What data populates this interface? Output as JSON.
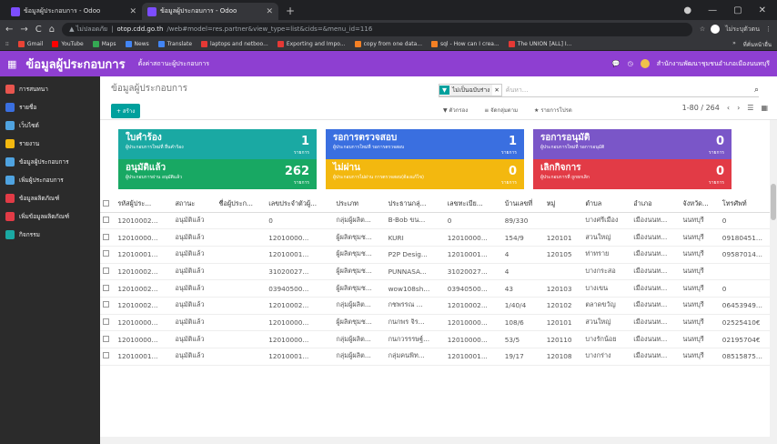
{
  "browser": {
    "tabs": [
      {
        "title": "ข้อมูลผู้ประกอบการ - Odoo",
        "active": false
      },
      {
        "title": "ข้อมูลผู้ประกอบการ - Odoo",
        "active": true
      }
    ],
    "new_tab": "+",
    "nav_back": "←",
    "nav_forward": "→",
    "nav_reload": "C",
    "nav_home": "⌂",
    "url_secure_label": "▲ ไม่ปลอดภัย",
    "url_host": "otop.cdd.go.th",
    "url_path": "/web#model=res.partner&view_type=list&cids=&menu_id=116",
    "profile_label": "ไม่ระบุตัวตน",
    "bookmarks": [
      "Gmail",
      "YouTube",
      "Maps",
      "News",
      "Translate",
      "laptops and netboo...",
      "Exporting and Impo...",
      "copy from one data...",
      "sql - How can I crea...",
      "The UNION [ALL] I..."
    ],
    "bookmarks_more": "»",
    "bookmarks_other": "ที่คั่นหน้าอื่น"
  },
  "odoo": {
    "brand": "ข้อมูลผู้ประกอบการ",
    "menu": "ตั้งค่าสถานะผู้ประกอบการ",
    "org": "สำนักงานพัฒนาชุมชนอำเภอเมืองนนทบุรี",
    "sidebar": [
      "การสนทนา",
      "รายชื่อ",
      "เว็บไซต์",
      "รายงาน",
      "ข้อมูลผู้ประกอบการ",
      "เพิ่มผู้ประกอบการ",
      "ข้อมูลผลิตภัณฑ์",
      "เพิ่มข้อมูลผลิตภัณฑ์",
      "กิจกรรม"
    ],
    "breadcrumb": "ข้อมูลผู้ประกอบการ",
    "create_button": "+ สร้าง",
    "facet_value": "ไม่เป็นฉบับร่าง",
    "search_placeholder": "ค้นหา...",
    "filters": [
      "▼ ตัวกรอง",
      "≡ จัดกลุ่มตาม",
      "★ รายการโปรด"
    ],
    "pager": "1-80 / 264",
    "tiles": [
      {
        "title": "ใบคำร้อง",
        "sub": "ผู้ประกอบการใหม่ที่ ยื่นคำร้อง",
        "count": "1",
        "unit": "รายการ",
        "color": "#1aa9a3"
      },
      {
        "title": "รอการตรวจสอบ",
        "sub": "ผู้ประกอบการใหม่ที่ รอการตรวจสอบ",
        "count": "1",
        "unit": "รายการ",
        "color": "#3a6fe0"
      },
      {
        "title": "รอการอนุมัติ",
        "sub": "ผู้ประกอบการใหม่ที่ รอการอนุมัติ",
        "count": "0",
        "unit": "รายการ",
        "color": "#7a56c8"
      },
      {
        "title": "อนุมัติแล้ว",
        "sub": "ผู้ประกอบการผ่าน อนุมัติแล้ว",
        "count": "262",
        "unit": "รายการ",
        "color": "#18a863"
      },
      {
        "title": "ไม่ผ่าน",
        "sub": "ผู้ประกอบการไม่ผ่าน การตรวจสอบ(ต้องแก้ไข)",
        "count": "0",
        "unit": "รายการ",
        "color": "#f3b80f"
      },
      {
        "title": "เลิกกิจการ",
        "sub": "ผู้ประกอบการที่ ถูกยกเลิก",
        "count": "0",
        "unit": "รายการ",
        "color": "#e23b46"
      }
    ],
    "columns": [
      "รหัสผู้ประ...",
      "สถานะ",
      "ชื่อผู้ประก...",
      "เลขประจำตัวผู้...",
      "ประเภท",
      "ประธานกลุ่...",
      "เลขทะเบีย...",
      "บ้านเลขที่",
      "หมู่",
      "ตำบล",
      "อำเภอ",
      "จังหวัด...",
      "โทรศัพท์"
    ],
    "rows": [
      [
        "12010002...",
        "อนุมัติแล้ว",
        "",
        "0",
        "กลุ่มผู้ผลิต...",
        "B-Bob ขน...",
        "0",
        "89/330",
        "",
        "บางศรีเมือง",
        "เมืองนนท...",
        "นนทบุรี",
        "0"
      ],
      [
        "12010000...",
        "อนุมัติแล้ว",
        "",
        "12010000...",
        "ผู้ผลิตชุมช...",
        "KURI",
        "12010000...",
        "154/9",
        "120101",
        "สวนใหญ่",
        "เมืองนนท...",
        "นนทบุรี",
        "09180451..."
      ],
      [
        "12010001...",
        "อนุมัติแล้ว",
        "",
        "12010001...",
        "ผู้ผลิตชุมช...",
        "P2P Desig...",
        "12010001...",
        "4",
        "120105",
        "ท่าทราย",
        "เมืองนนท...",
        "นนทบุรี",
        "09587014..."
      ],
      [
        "12010002...",
        "อนุมัติแล้ว",
        "",
        "31020027...",
        "ผู้ผลิตชุมช...",
        "PUNNASA...",
        "31020027...",
        "4",
        "",
        "บางกระสอ",
        "เมืองนนท...",
        "นนทบุรี",
        ""
      ],
      [
        "12010002...",
        "อนุมัติแล้ว",
        "",
        "03940500...",
        "ผู้ผลิตชุมช...",
        "wow108sh...",
        "03940500...",
        "43",
        "120103",
        "บางเขน",
        "เมืองนนท...",
        "นนทบุรี",
        "0"
      ],
      [
        "12010002...",
        "อนุมัติแล้ว",
        "",
        "12010002...",
        "กลุ่มผู้ผลิต...",
        "กชพรรณ ...",
        "12010002...",
        "1/40/4",
        "120102",
        "ตลาดขวัญ",
        "เมืองนนท...",
        "นนทบุรี",
        "06453949..."
      ],
      [
        "12010000...",
        "อนุมัติแล้ว",
        "",
        "12010000...",
        "ผู้ผลิตชุมช...",
        "กนกพร จิร...",
        "12010000...",
        "108/6",
        "120101",
        "สวนใหญ่",
        "เมืองนนท...",
        "นนทบุรี",
        "02525410€"
      ],
      [
        "12010000...",
        "อนุมัติแล้ว",
        "",
        "12010000...",
        "กลุ่มผู้ผลิต...",
        "กนกวรรรษฐ์...",
        "12010000...",
        "53/5",
        "120110",
        "บางรักน้อย",
        "เมืองนนท...",
        "นนทบุรี",
        "02195704€"
      ],
      [
        "12010001...",
        "อนุมัติแล้ว",
        "",
        "12010001...",
        "กลุ่มผู้ผลิต...",
        "กลุ่มคนพิท...",
        "12010001...",
        "19/17",
        "120108",
        "บางกร่าง",
        "เมืองนนท...",
        "นนทบุรี",
        "08515875..."
      ]
    ]
  }
}
